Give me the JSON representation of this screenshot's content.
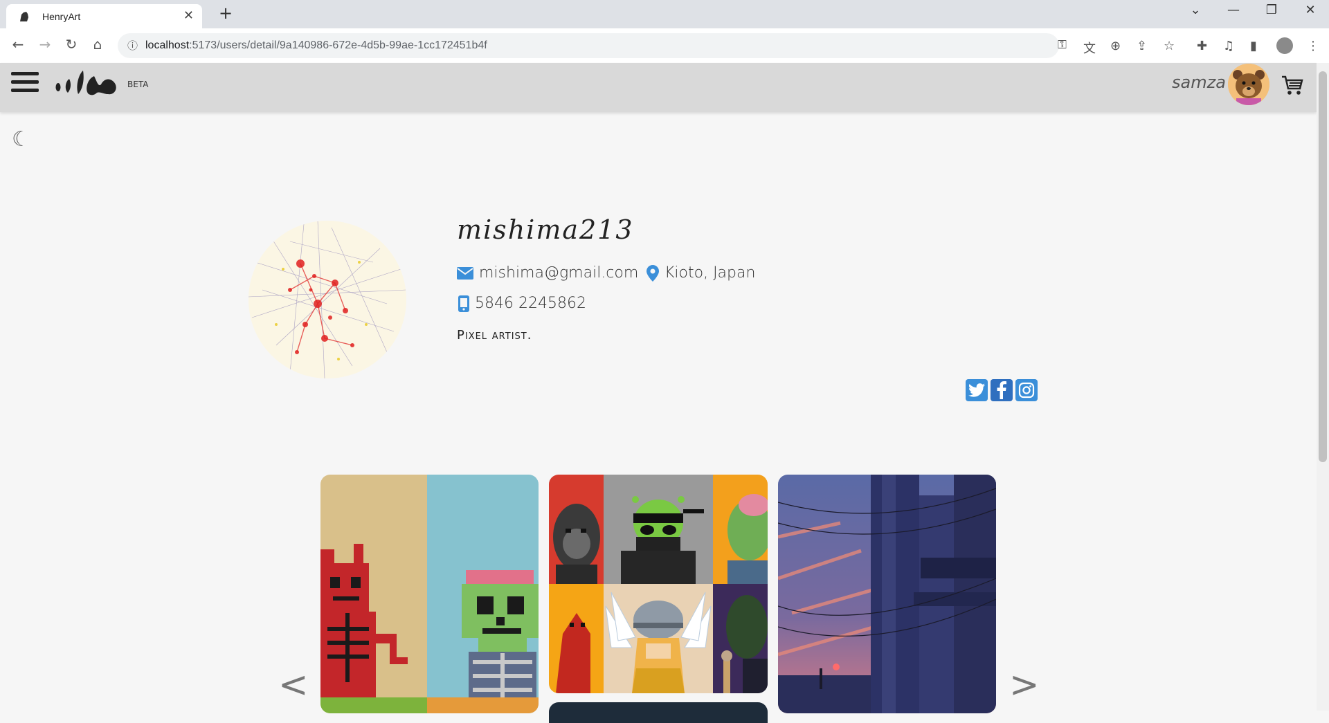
{
  "browser": {
    "tab_title": "HenryArt",
    "url_host": "localhost",
    "url_rest": ":5173/users/detail/9a140986-672e-4d5b-99ae-1cc172451b4f"
  },
  "header": {
    "beta_label": "BETA",
    "username": "samza"
  },
  "profile": {
    "username": "mishima213",
    "email": "mishima@gmail.com",
    "location": "Kioto, Japan",
    "phone": "5846 2245862",
    "bio": "Pixel artist."
  },
  "socials": [
    "twitter-icon",
    "facebook-icon",
    "instagram-icon"
  ],
  "carousel": {
    "prev_label": "<",
    "next_label": ">"
  },
  "colors": {
    "accent": "#3b8fd9",
    "header_bg": "#d9d9d9",
    "page_bg": "#f6f6f6",
    "twitter": "#1da1f2",
    "facebook": "#1877f2",
    "instagram": "#3b8fd9"
  }
}
